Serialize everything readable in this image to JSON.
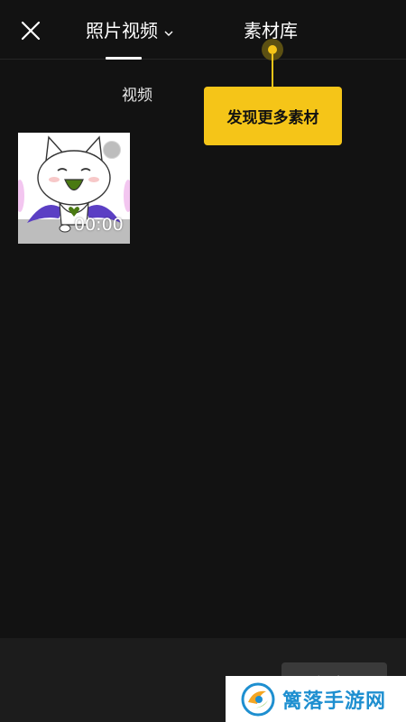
{
  "header": {
    "tabs": [
      {
        "label": "照片视频",
        "active": true
      },
      {
        "label": "素材库",
        "active": false
      }
    ]
  },
  "sub_tabs": [
    {
      "label": "视频",
      "active": true
    }
  ],
  "tooltip": {
    "text": "发现更多素材",
    "color": "#f5c518"
  },
  "media_items": [
    {
      "duration": "00:00",
      "selected": false
    }
  ],
  "footer": {
    "add_label": "添加"
  },
  "watermark": {
    "text": "篱落手游网"
  },
  "colors": {
    "background": "#121212",
    "accent": "#f5c518",
    "watermark_blue": "#1e8fd0"
  }
}
